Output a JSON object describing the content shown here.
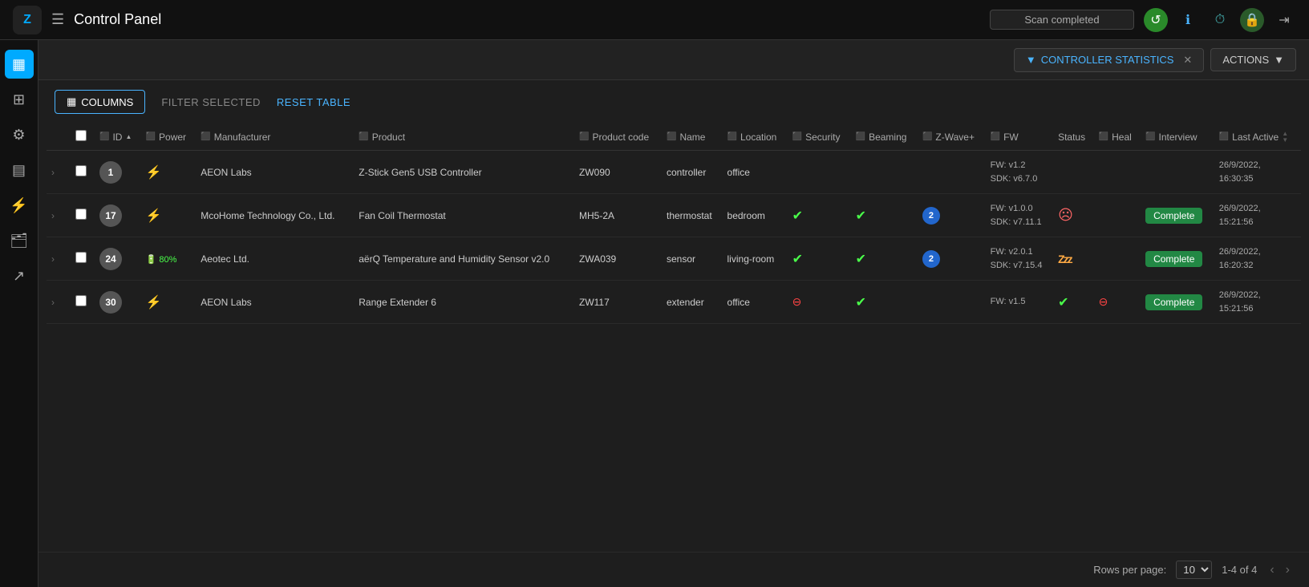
{
  "topbar": {
    "logo": "Z",
    "menu_icon": "☰",
    "title": "Control Panel",
    "scan_status": "Scan completed",
    "icons": [
      {
        "name": "refresh-icon",
        "symbol": "↺",
        "class": "green"
      },
      {
        "name": "info-icon",
        "symbol": "ℹ",
        "class": "blue"
      },
      {
        "name": "history-icon",
        "symbol": "⏱",
        "class": "teal"
      },
      {
        "name": "lock-icon",
        "symbol": "🔒",
        "class": "lock"
      },
      {
        "name": "exit-icon",
        "symbol": "⇥",
        "class": "exit"
      }
    ]
  },
  "header": {
    "stats_label": "CONTROLLER STATISTICS",
    "actions_label": "ACTIONS"
  },
  "toolbar": {
    "columns_label": "COLUMNS",
    "filter_selected_label": "FILTER SELECTED",
    "reset_table_label": "RESET TABLE"
  },
  "table": {
    "columns": [
      {
        "id": "expand",
        "label": ""
      },
      {
        "id": "checkbox",
        "label": ""
      },
      {
        "id": "id",
        "label": "ID",
        "sortable": true
      },
      {
        "id": "power",
        "label": "Power"
      },
      {
        "id": "manufacturer",
        "label": "Manufacturer"
      },
      {
        "id": "product",
        "label": "Product"
      },
      {
        "id": "product_code",
        "label": "Product code"
      },
      {
        "id": "name",
        "label": "Name"
      },
      {
        "id": "location",
        "label": "Location"
      },
      {
        "id": "security",
        "label": "Security"
      },
      {
        "id": "beaming",
        "label": "Beaming"
      },
      {
        "id": "zwave_plus",
        "label": "Z-Wave+"
      },
      {
        "id": "fw",
        "label": "FW"
      },
      {
        "id": "status",
        "label": "Status"
      },
      {
        "id": "heal",
        "label": "Heal"
      },
      {
        "id": "interview",
        "label": "Interview"
      },
      {
        "id": "last_active",
        "label": "Last Active"
      }
    ],
    "rows": [
      {
        "id": 1,
        "power_type": "plug",
        "manufacturer": "AEON Labs",
        "product": "Z-Stick Gen5 USB Controller",
        "product_code": "ZW090",
        "name": "controller",
        "location": "office",
        "security": "",
        "beaming": "",
        "zwave_plus": "",
        "fw": "FW: v1.2\nSDK: v6.7.0",
        "status": "",
        "heal": "",
        "interview": "",
        "last_active": "26/9/2022,\n16:30:35"
      },
      {
        "id": 17,
        "power_type": "plug",
        "manufacturer": "McoHome Technology Co., Ltd.",
        "product": "Fan Coil Thermostat",
        "product_code": "MH5-2A",
        "name": "thermostat",
        "location": "bedroom",
        "security": "ok",
        "beaming": "ok",
        "zwave_plus": "2",
        "fw": "FW: v1.0.0\nSDK: v7.11.1",
        "status": "sad",
        "heal": "",
        "interview": "Complete",
        "last_active": "26/9/2022,\n15:21:56"
      },
      {
        "id": 24,
        "power_type": "battery",
        "power_pct": "80%",
        "manufacturer": "Aeotec Ltd.",
        "product": "aërQ Temperature and Humidity Sensor v2.0",
        "product_code": "ZWA039",
        "name": "sensor",
        "location": "living-room",
        "security": "ok",
        "beaming": "ok",
        "zwave_plus": "2",
        "fw": "FW: v2.0.1\nSDK: v7.15.4",
        "status": "sleep",
        "heal": "",
        "interview": "Complete",
        "last_active": "26/9/2022,\n16:20:32"
      },
      {
        "id": 30,
        "power_type": "plug",
        "manufacturer": "AEON Labs",
        "product": "Range Extender 6",
        "product_code": "ZW117",
        "name": "extender",
        "location": "office",
        "security": "error",
        "beaming": "ok",
        "zwave_plus": "",
        "fw": "FW: v1.5",
        "status": "check",
        "heal": "error",
        "interview": "Complete",
        "last_active": "26/9/2022,\n15:21:56"
      }
    ]
  },
  "pagination": {
    "rows_per_page_label": "Rows per page:",
    "rows_per_page_value": "10",
    "range_label": "1-4 of 4"
  },
  "sidebar": {
    "items": [
      {
        "name": "grid-icon",
        "symbol": "▦",
        "active": true
      },
      {
        "name": "modules-icon",
        "symbol": "⊞",
        "active": false
      },
      {
        "name": "settings-icon",
        "symbol": "⚙",
        "active": false
      },
      {
        "name": "layers-icon",
        "symbol": "▤",
        "active": false
      },
      {
        "name": "rules-icon",
        "symbol": "⚡",
        "active": false
      },
      {
        "name": "folder-icon",
        "symbol": "📁",
        "active": false
      },
      {
        "name": "share-icon",
        "symbol": "↗",
        "active": false
      }
    ]
  }
}
